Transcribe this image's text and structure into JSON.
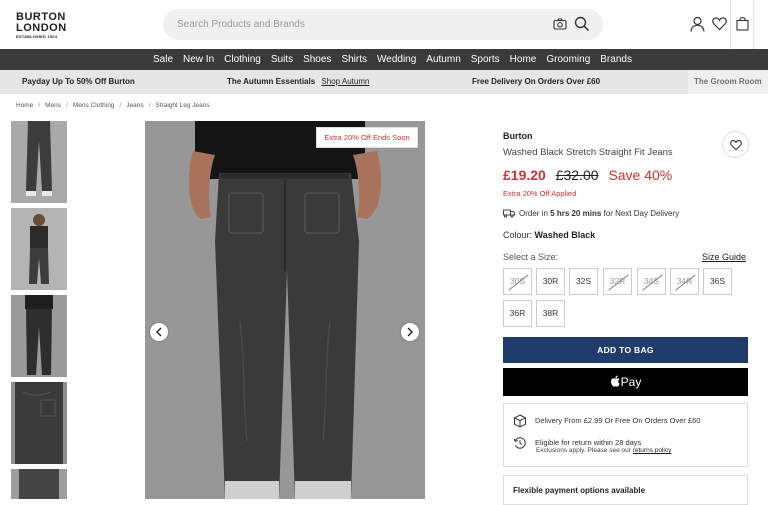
{
  "header": {
    "logo": {
      "line1": "BURTON",
      "line2": "LONDON",
      "line3": "ESTABLISHED 1904"
    },
    "search_placeholder": "Search Products and Brands",
    "icons": [
      "camera-icon",
      "search-icon",
      "account-icon",
      "heart-icon",
      "bag-icon"
    ]
  },
  "nav": {
    "items": [
      "Sale",
      "New In",
      "Clothing",
      "Suits",
      "Shoes",
      "Shirts",
      "Wedding",
      "Autumn",
      "Sports",
      "Home",
      "Grooming",
      "Brands"
    ]
  },
  "promo": {
    "left": "Payday Up To 50% Off Burton",
    "middle": "The Autumn Essentials",
    "middle_link": "Shop Autumn",
    "right": "Free Delivery On Orders Over £60",
    "far_right": "The Groom Room"
  },
  "breadcrumb": [
    "Home",
    "Mens",
    "Mens Clothing",
    "Jeans",
    "Straight Leg Jeans"
  ],
  "gallery": {
    "badge": "Extra 20% Off Ends Soon",
    "thumbnails": 5
  },
  "product": {
    "brand": "Burton",
    "name": "Washed Black Stretch Straight Fit Jeans",
    "price_now": "£19.20",
    "price_was": "£32.00",
    "saving": "Save 40%",
    "extra_offer": "Extra 20% Off Applied",
    "delivery_prefix": "Order in",
    "delivery_time": "5 hrs 20 mins",
    "delivery_suffix": "for Next Day Delivery",
    "colour_label": "Colour:",
    "colour_value": "Washed Black",
    "size_label": "Select a Size:",
    "size_guide": "Size Guide",
    "sizes": [
      {
        "label": "30S",
        "available": false
      },
      {
        "label": "30R",
        "available": true
      },
      {
        "label": "32S",
        "available": true
      },
      {
        "label": "32R",
        "available": false
      },
      {
        "label": "34S",
        "available": false
      },
      {
        "label": "34R",
        "available": false
      },
      {
        "label": "36S",
        "available": true
      },
      {
        "label": "36R",
        "available": true
      },
      {
        "label": "38R",
        "available": true
      }
    ],
    "add_to_bag": "ADD TO BAG",
    "apple_pay": "Pay"
  },
  "info": {
    "delivery": "Delivery From £2.99 Or Free On Orders Over £60",
    "returns": "Eligible for return within 28 days",
    "returns_sub": "Exclusions apply. Please see our",
    "returns_link": "returns policy"
  },
  "payment": {
    "title": "Flexible payment options available"
  },
  "colors": {
    "sale_red": "#d0302f",
    "nav_bg": "#3a3a3a",
    "add_btn": "#203c6b"
  }
}
